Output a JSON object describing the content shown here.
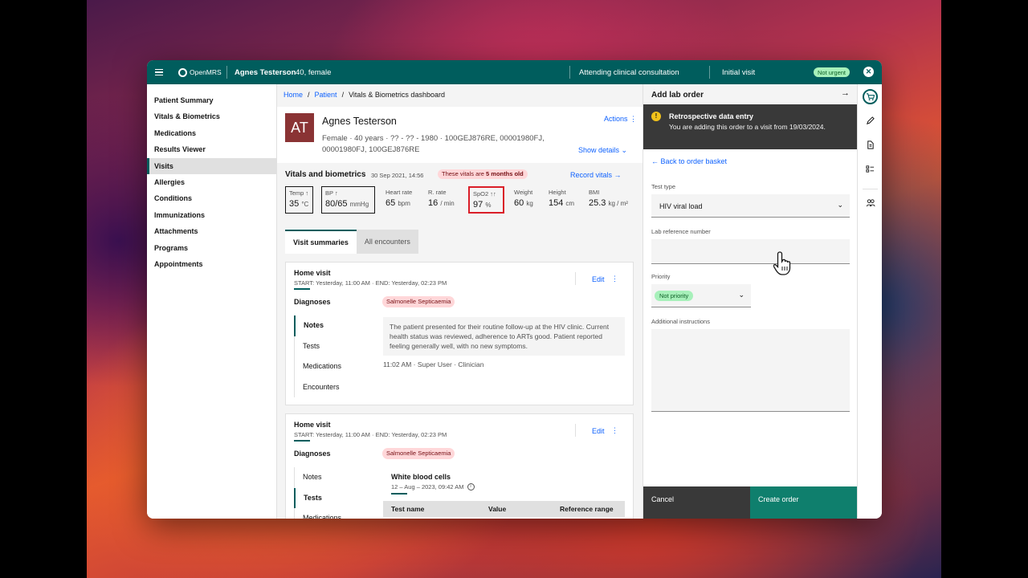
{
  "topbar": {
    "logo_text": "OpenMRS",
    "patient_name": "Agnes Testerson",
    "patient_meta": "40, female",
    "visit_status": "Attending clinical consultation",
    "visit_type": "Initial visit",
    "urgency": "Not urgent",
    "colors": {
      "brand": "#005d5d"
    }
  },
  "leftnav": {
    "items": [
      {
        "label": "Patient Summary",
        "active": false
      },
      {
        "label": "Vitals & Biometrics",
        "active": false
      },
      {
        "label": "Medications",
        "active": false
      },
      {
        "label": "Results Viewer",
        "active": false
      },
      {
        "label": "Visits",
        "active": true
      },
      {
        "label": "Allergies",
        "active": false
      },
      {
        "label": "Conditions",
        "active": false
      },
      {
        "label": "Immunizations",
        "active": false
      },
      {
        "label": "Attachments",
        "active": false
      },
      {
        "label": "Programs",
        "active": false
      },
      {
        "label": "Appointments",
        "active": false
      }
    ]
  },
  "breadcrumb": [
    "Home",
    "/",
    "Patient",
    "/",
    "Vitals & Biometrics dashboard"
  ],
  "patient_header": {
    "initials": "AT",
    "name": "Agnes Testerson",
    "info": "Female · 40 years · ?? - ?? - 1980 · 100GEJ876RE, 00001980FJ, 00001980FJ, 100GEJ876RE",
    "actions": "Actions ⋮",
    "show_details": "Show details ⌄"
  },
  "vitals": {
    "title": "Vitals and biometrics",
    "date": "30 Sep 2021, 14:56",
    "badge_prefix": "These vitals are",
    "badge_bold": "5 months old",
    "record": "Record vitals →",
    "items": [
      {
        "label": "Temp ↑",
        "value": "35",
        "unit": "°C"
      },
      {
        "label": "BP ↑",
        "value": "80/65",
        "unit": "mmHg"
      },
      {
        "label": "Heart rate",
        "value": "65",
        "unit": "bpm"
      },
      {
        "label": "R. rate",
        "value": "16",
        "unit": "/ min"
      },
      {
        "label": "SpO2 ↑↑",
        "value": "97",
        "unit": "%"
      },
      {
        "label": "Weight",
        "value": "60",
        "unit": "kg"
      },
      {
        "label": "Height",
        "value": "154",
        "unit": "cm"
      },
      {
        "label": "BMI",
        "value": "25.3",
        "unit": "kg / m²"
      }
    ]
  },
  "tabs": [
    {
      "label": "Visit summaries",
      "active": true
    },
    {
      "label": "All encounters",
      "active": false
    }
  ],
  "visits": [
    {
      "title": "Home visit",
      "dates": "START: Yesterday, 11:00 AM · END: Yesterday, 02:23 PM",
      "edit": "Edit",
      "diagnoses_label": "Diagnoses",
      "diagnosis": "Salmonelle Septicaemia",
      "side_tabs": [
        "Notes",
        "Tests",
        "Medications",
        "Encounters"
      ],
      "note": "The patient presented for their routine follow-up at the HIV clinic. Current health status was reviewed, adherence to ARTs good. Patient reported feeling generally well, with no new symptoms.",
      "note_meta": "11:02 AM · Super User · Clinician"
    },
    {
      "title": "Home visit",
      "dates": "START: Yesterday, 11:00 AM · END: Yesterday, 02:23 PM",
      "edit": "Edit",
      "diagnoses_label": "Diagnoses",
      "diagnosis": "Salmonelle Septicaemia",
      "side_tabs": [
        "Notes",
        "Tests",
        "Medications"
      ],
      "test_title": "White blood cells",
      "test_date": "12 – Aug – 2023, 09:42 AM",
      "table_headers": [
        "Test name",
        "Value",
        "Reference range"
      ]
    }
  ],
  "lab_order": {
    "title": "Add lab order",
    "warning_title": "Retrospective data entry",
    "warning_text": "You are adding this order to a visit from 19/03/2024.",
    "back_link": "← Back to order basket",
    "test_type_label": "Test type",
    "test_type_value": "HIV viral load",
    "lab_ref_label": "Lab reference number",
    "lab_ref_value": "",
    "priority_label": "Priority",
    "priority_value": "Not priority",
    "instructions_label": "Additional instructions",
    "cancel": "Cancel",
    "create": "Create order"
  },
  "rail": {
    "icons": [
      "shopping-cart-icon",
      "pen-icon",
      "document-icon",
      "checklist-icon",
      "group-icon"
    ]
  }
}
